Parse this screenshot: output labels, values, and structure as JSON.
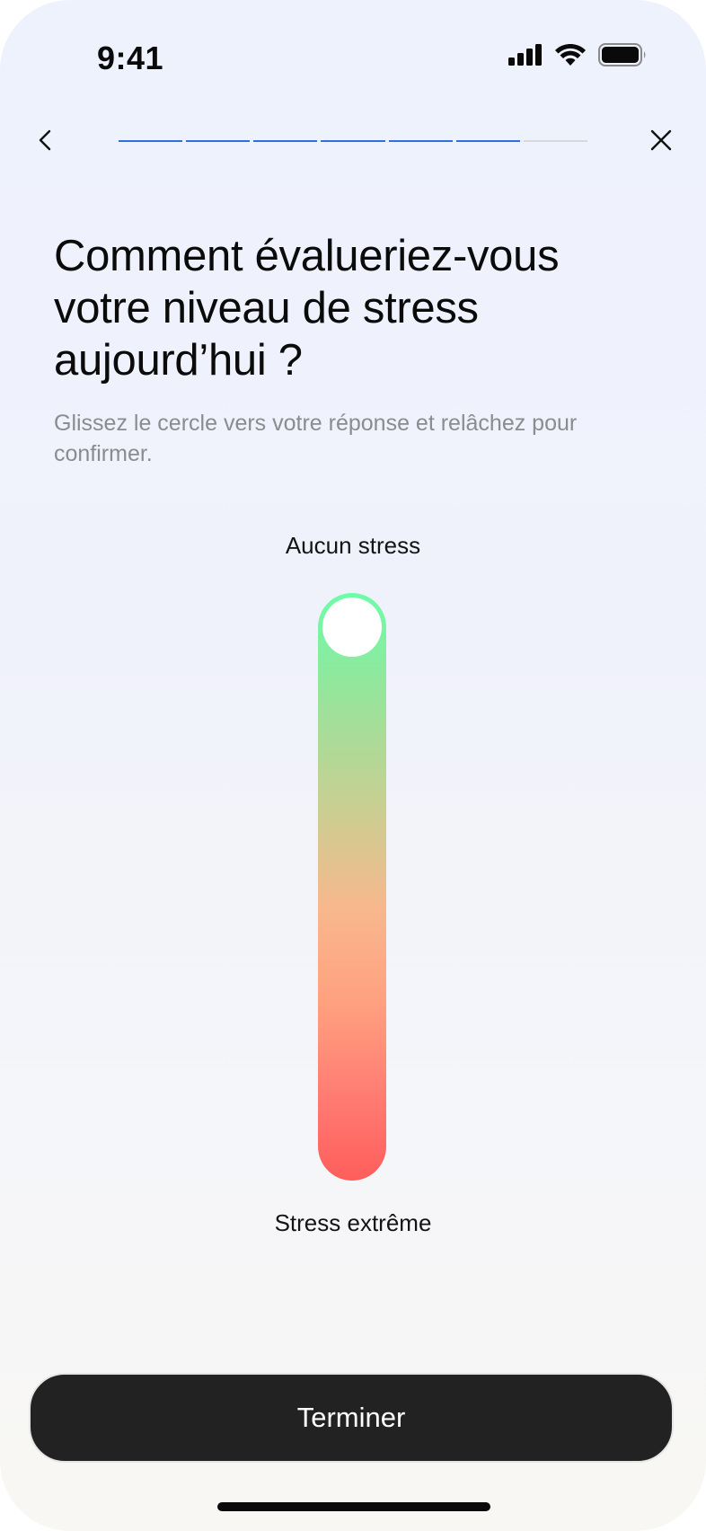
{
  "status_bar": {
    "time": "9:41",
    "icons": [
      "cellular-signal-icon",
      "wifi-icon",
      "battery-icon"
    ]
  },
  "nav": {
    "back_icon": "chevron-left-icon",
    "close_icon": "close-icon",
    "progress": {
      "total_steps": 7,
      "completed_steps": 6,
      "accent": "#2f6fe0",
      "track": "#d6d8de"
    }
  },
  "question": {
    "title": "Comment évalueriez-vous votre niveau de stress aujourd’hui ?",
    "subtitle": "Glissez le cercle vers votre réponse et relâchez pour confirmer."
  },
  "slider": {
    "top_label": "Aucun stress",
    "bottom_label": "Stress extrême",
    "value": 0,
    "colors": {
      "top": "#6cfca8",
      "middle": "#f8b78c",
      "bottom": "#ff5e5c"
    }
  },
  "footer": {
    "finish_label": "Terminer"
  }
}
